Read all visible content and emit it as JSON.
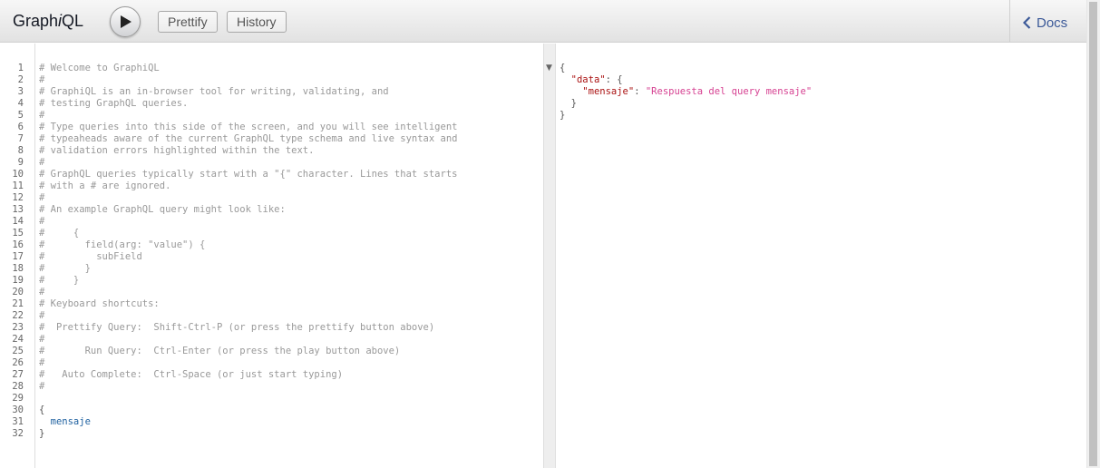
{
  "toolbar": {
    "title_prefix": "Graph",
    "title_italic": "i",
    "title_suffix": "QL",
    "prettify_label": "Prettify",
    "history_label": "History",
    "docs_label": "Docs"
  },
  "editor": {
    "lines": [
      {
        "n": "1",
        "text": "# Welcome to GraphiQL",
        "kind": "comment"
      },
      {
        "n": "2",
        "text": "#",
        "kind": "comment"
      },
      {
        "n": "3",
        "text": "# GraphiQL is an in-browser tool for writing, validating, and",
        "kind": "comment"
      },
      {
        "n": "4",
        "text": "# testing GraphQL queries.",
        "kind": "comment"
      },
      {
        "n": "5",
        "text": "#",
        "kind": "comment"
      },
      {
        "n": "6",
        "text": "# Type queries into this side of the screen, and you will see intelligent",
        "kind": "comment"
      },
      {
        "n": "7",
        "text": "# typeaheads aware of the current GraphQL type schema and live syntax and",
        "kind": "comment"
      },
      {
        "n": "8",
        "text": "# validation errors highlighted within the text.",
        "kind": "comment"
      },
      {
        "n": "9",
        "text": "#",
        "kind": "comment"
      },
      {
        "n": "10",
        "text": "# GraphQL queries typically start with a \"{\" character. Lines that starts",
        "kind": "comment"
      },
      {
        "n": "11",
        "text": "# with a # are ignored.",
        "kind": "comment"
      },
      {
        "n": "12",
        "text": "#",
        "kind": "comment"
      },
      {
        "n": "13",
        "text": "# An example GraphQL query might look like:",
        "kind": "comment"
      },
      {
        "n": "14",
        "text": "#",
        "kind": "comment"
      },
      {
        "n": "15",
        "text": "#     {",
        "kind": "comment"
      },
      {
        "n": "16",
        "text": "#       field(arg: \"value\") {",
        "kind": "comment"
      },
      {
        "n": "17",
        "text": "#         subField",
        "kind": "comment"
      },
      {
        "n": "18",
        "text": "#       }",
        "kind": "comment"
      },
      {
        "n": "19",
        "text": "#     }",
        "kind": "comment"
      },
      {
        "n": "20",
        "text": "#",
        "kind": "comment"
      },
      {
        "n": "21",
        "text": "# Keyboard shortcuts:",
        "kind": "comment"
      },
      {
        "n": "22",
        "text": "#",
        "kind": "comment"
      },
      {
        "n": "23",
        "text": "#  Prettify Query:  Shift-Ctrl-P (or press the prettify button above)",
        "kind": "comment"
      },
      {
        "n": "24",
        "text": "#",
        "kind": "comment"
      },
      {
        "n": "25",
        "text": "#       Run Query:  Ctrl-Enter (or press the play button above)",
        "kind": "comment"
      },
      {
        "n": "26",
        "text": "#",
        "kind": "comment"
      },
      {
        "n": "27",
        "text": "#   Auto Complete:  Ctrl-Space (or just start typing)",
        "kind": "comment"
      },
      {
        "n": "28",
        "text": "#",
        "kind": "comment"
      },
      {
        "n": "29",
        "text": "",
        "kind": "comment"
      },
      {
        "n": "30",
        "text": "{",
        "kind": "punct"
      },
      {
        "n": "31",
        "text": "  mensaje",
        "kind": "field"
      },
      {
        "n": "32",
        "text": "}",
        "kind": "punct"
      }
    ]
  },
  "result": {
    "open_brace": "{",
    "data_key": "\"data\"",
    "colon_open": ": {",
    "mensaje_key": "\"mensaje\"",
    "colon": ": ",
    "mensaje_value": "\"Respuesta del query mensaje\"",
    "inner_close": "}",
    "close_brace": "}",
    "fold_marker": "▼"
  },
  "icons": {
    "run": "play-icon",
    "docs": "chevron-left-icon"
  },
  "colors": {
    "docs_link": "#3b5998",
    "json_key": "#aa1111",
    "json_string": "#d64292",
    "field": "#1f61a0"
  }
}
